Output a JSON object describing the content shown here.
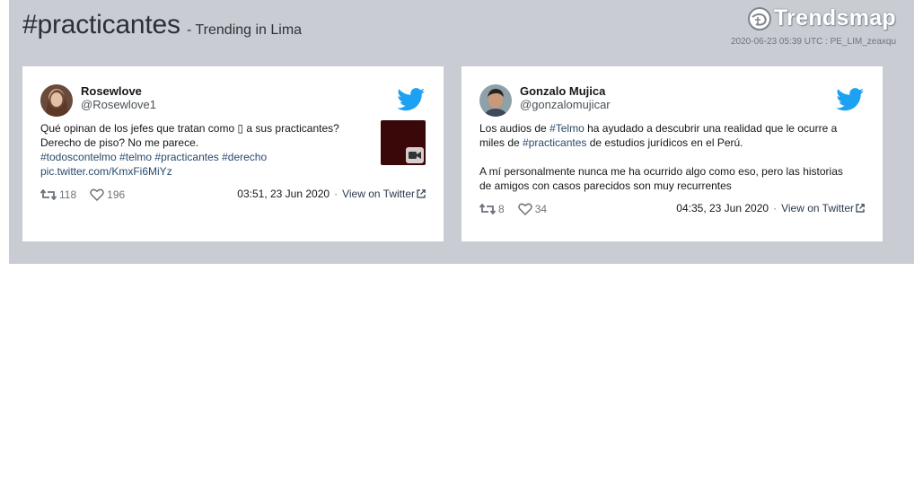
{
  "header": {
    "hashtag": "#practicantes",
    "subtitle": "- Trending in Lima",
    "logo_text": "Trendsmap",
    "timestamp": "2020-06-23 05:39 UTC : PE_LIM_zeaxqu"
  },
  "tweets": [
    {
      "name": "Rosewlove",
      "handle": "@Rosewlove1",
      "text_line1": "Qué opinan de los jefes que tratan como ▯ a sus practicantes?",
      "text_line2": "Derecho de piso? No me parece.",
      "hashtags_line": "#todoscontelmo #telmo #practicantes #derecho",
      "pic_link": "pic.twitter.com/KmxFi6MiYz",
      "retweets": "118",
      "likes": "196",
      "time": "03:51, 23 Jun 2020",
      "view_label": "View on Twitter",
      "has_media": true,
      "media_icon": "video-camera-icon"
    },
    {
      "name": "Gonzalo Mujica",
      "handle": "@gonzalomujicar",
      "para1_a": "Los audios de ",
      "para1_tag1": "#Telmo",
      "para1_b": " ha ayudado a descubrir una realidad que le ocurre a miles de ",
      "para1_tag2": "#practicantes",
      "para1_c": " de estudios jurídicos en el Perú.",
      "para2": "A mí personalmente nunca me ha ocurrido algo como eso, pero las historias de amigos con casos parecidos son muy recurrentes",
      "retweets": "8",
      "likes": "34",
      "time": "04:35, 23 Jun 2020",
      "view_label": "View on Twitter"
    }
  ],
  "colors": {
    "panel_bg": "#c9ccd3",
    "twitter_blue": "#1da1f2",
    "link": "#2a4a6b"
  }
}
